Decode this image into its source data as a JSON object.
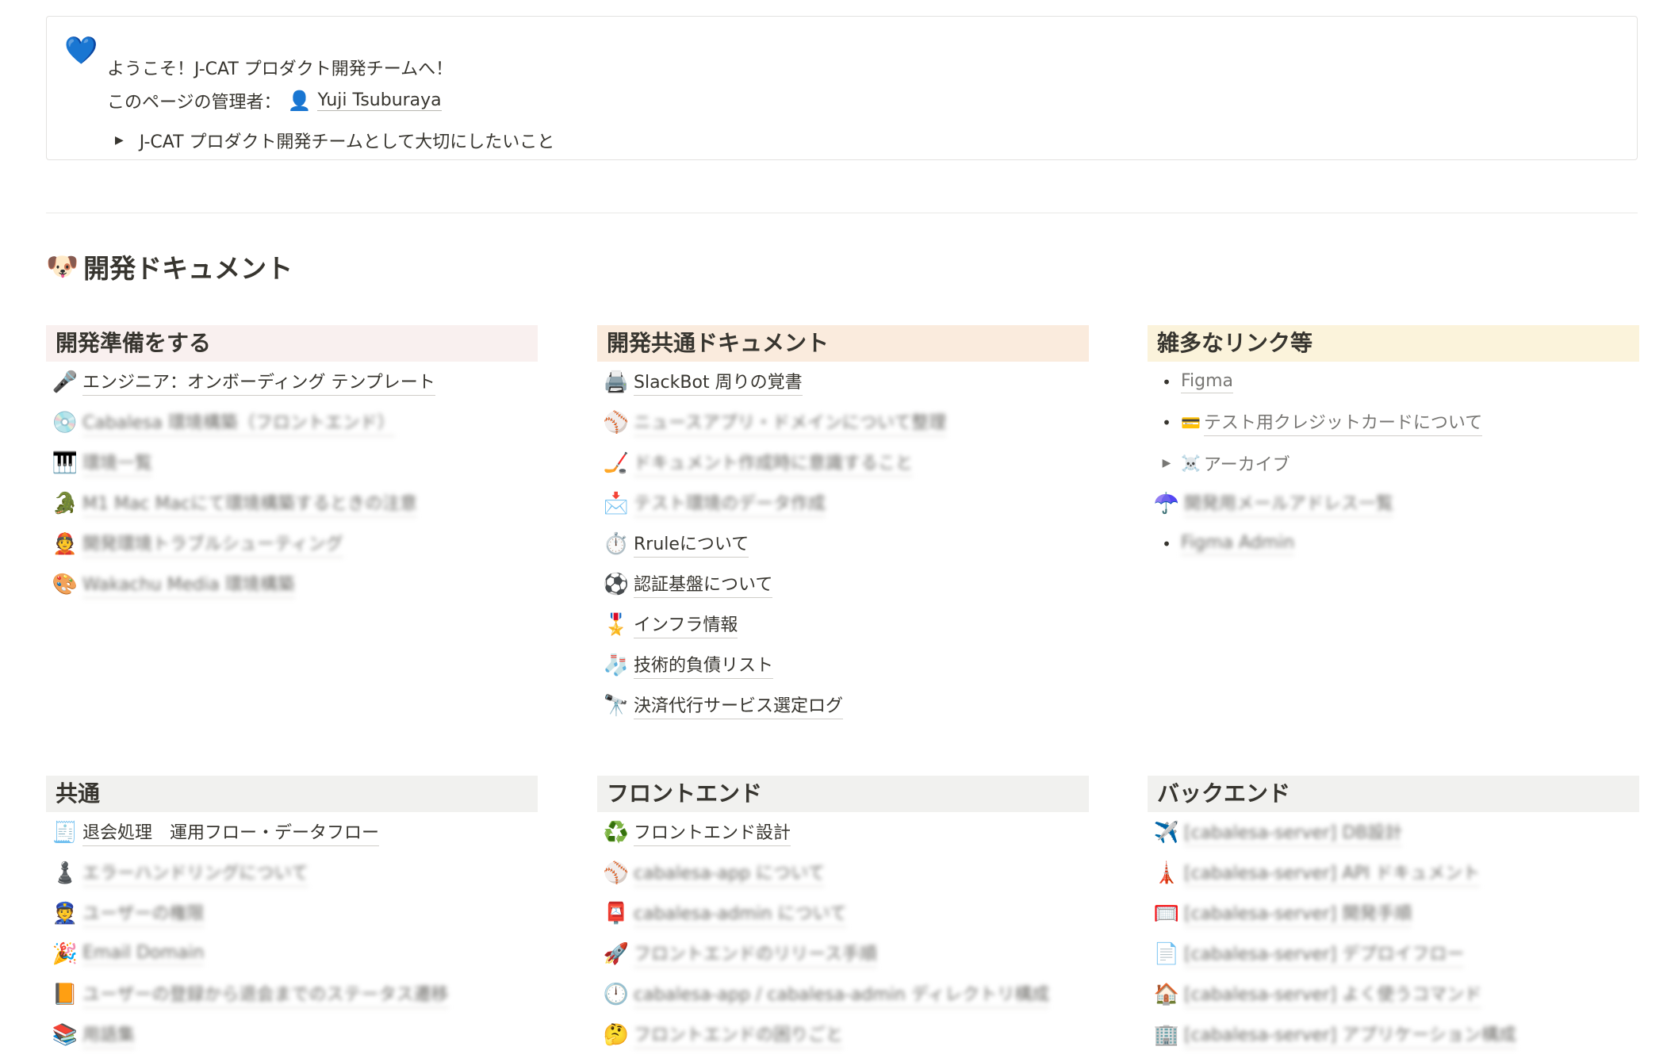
{
  "callout": {
    "icon": "💙",
    "line1": "ようこそ！J-CAT プロダクト開発チームへ！",
    "line2_prefix": "このページの管理者：",
    "manager_icon": "👤",
    "manager_name": "Yuji Tsuburaya",
    "toggle_arrow": "▶",
    "toggle_text": "J-CAT プロダクト開発チームとして大切にしたいこと"
  },
  "section": {
    "icon": "🐶",
    "title": "開発ドキュメント"
  },
  "columns": {
    "prep": {
      "title": "開発準備をする",
      "items": [
        {
          "icon": "🎤",
          "label": "エンジニア：オンボーディング テンプレート"
        },
        {
          "icon": "💿",
          "label": "Cabalesa 環境構築（フロントエンド）"
        },
        {
          "icon": "🎹",
          "label": "環境一覧"
        },
        {
          "icon": "🐊",
          "label": "M1 Mac Macにて環境構築するときの注意"
        },
        {
          "icon": "👲",
          "label": "開発環境トラブルシューティング"
        },
        {
          "icon": "🎨",
          "label": "Wakachu Media 環境構築"
        }
      ]
    },
    "common_docs": {
      "title": "開発共通ドキュメント",
      "items": [
        {
          "icon": "🖨️",
          "label": "SlackBot 周りの覚書"
        },
        {
          "icon": "⚾",
          "label": "ニュースアプリ・ドメインについて整理"
        },
        {
          "icon": "🏒",
          "label": "ドキュメント作成時に意識すること"
        },
        {
          "icon": "📩",
          "label": "テスト環境のデータ作成"
        },
        {
          "icon": "⏱️",
          "label": "Rruleについて"
        },
        {
          "icon": "⚽",
          "label": "認証基盤について"
        },
        {
          "icon": "🎖️",
          "label": "インフラ情報"
        },
        {
          "icon": "🧦",
          "label": "技術的負債リスト"
        },
        {
          "icon": "🔭",
          "label": "決済代行サービス選定ログ"
        }
      ]
    },
    "links": {
      "title": "雑多なリンク等",
      "items": [
        {
          "kind": "bullet",
          "marker": "•",
          "label": "Figma"
        },
        {
          "kind": "bullet",
          "marker": "•",
          "icon": "💳",
          "label": "テスト用クレジットカードについて"
        },
        {
          "kind": "toggle",
          "marker": "▶",
          "icon": "☠️",
          "label": "アーカイブ"
        },
        {
          "kind": "page",
          "icon": "☂️",
          "label": "開発用メールアドレス一覧"
        },
        {
          "kind": "bullet",
          "marker": "•",
          "label": "Figma Admin"
        }
      ]
    },
    "shared": {
      "title": "共通",
      "items": [
        {
          "icon": "🧾",
          "label": "退会処理　運用フロー・データフロー"
        },
        {
          "icon": "♟️",
          "label": "エラーハンドリングについて"
        },
        {
          "icon": "👮",
          "label": "ユーザーの権限"
        },
        {
          "icon": "🎉",
          "label": "Email Domain"
        },
        {
          "icon": "📙",
          "label": "ユーザーの登録から退会までのステータス遷移"
        },
        {
          "icon": "📚",
          "label": "用語集"
        }
      ]
    },
    "frontend": {
      "title": "フロントエンド",
      "items": [
        {
          "icon": "♻️",
          "label": "フロントエンド設計"
        },
        {
          "icon": "⚾",
          "label": "cabalesa-app について"
        },
        {
          "icon": "📮",
          "label": "cabalesa-admin について"
        },
        {
          "icon": "🚀",
          "label": "フロントエンドのリリース手順"
        },
        {
          "icon": "🕛",
          "label": "cabalesa-app / cabalesa-admin ディレクトリ構成"
        },
        {
          "icon": "🤔",
          "label": "フロントエンドの困りごと"
        }
      ]
    },
    "backend": {
      "title": "バックエンド",
      "items": [
        {
          "icon": "✈️",
          "label": "[cabalesa-server] DB設計"
        },
        {
          "icon": "🗼",
          "label": "[cabalesa-server] API ドキュメント"
        },
        {
          "icon": "🥅",
          "label": "[cabalesa-server] 開発手順"
        },
        {
          "icon": "📄",
          "label": "[cabalesa-server] デプロイフロー"
        },
        {
          "icon": "🏠",
          "label": "[cabalesa-server] よく使うコマンド"
        },
        {
          "icon": "🏢",
          "label": "[cabalesa-server] アプリケーション構成"
        }
      ]
    }
  }
}
